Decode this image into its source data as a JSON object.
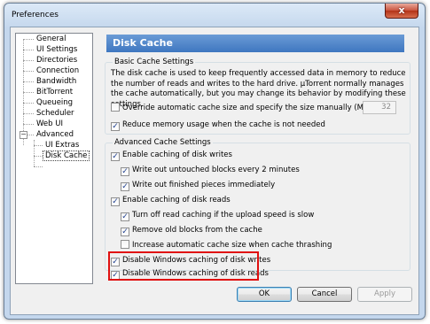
{
  "window": {
    "title": "Preferences",
    "close_glyph": "x"
  },
  "sidebar": {
    "items": [
      {
        "label": "General"
      },
      {
        "label": "UI Settings"
      },
      {
        "label": "Directories"
      },
      {
        "label": "Connection"
      },
      {
        "label": "Bandwidth"
      },
      {
        "label": "BitTorrent"
      },
      {
        "label": "Queueing"
      },
      {
        "label": "Scheduler"
      },
      {
        "label": "Web UI"
      },
      {
        "label": "Advanced",
        "expander": "−"
      },
      {
        "label": "UI Extras"
      },
      {
        "label": "Disk Cache",
        "selected": true
      }
    ]
  },
  "page": {
    "title": "Disk Cache",
    "basic": {
      "title": "Basic Cache Settings",
      "description": "The disk cache is used to keep frequently accessed data in memory to reduce the number of reads and writes to the hard drive. µTorrent normally manages the cache automatically, but you may change its behavior by modifying these settings.",
      "override_label": "Override automatic cache size and specify the size manually (MB):",
      "override_checked": false,
      "cache_size_value": "32",
      "reduce_label": "Reduce memory usage when the cache is not needed",
      "reduce_checked": true
    },
    "advanced": {
      "title": "Advanced Cache Settings",
      "options": [
        {
          "label": "Enable caching of disk writes",
          "checked": true
        },
        {
          "label": "Write out untouched blocks every 2 minutes",
          "checked": true
        },
        {
          "label": "Write out finished pieces immediately",
          "checked": true
        },
        {
          "label": "Enable caching of disk reads",
          "checked": true
        },
        {
          "label": "Turn off read caching if the upload speed is slow",
          "checked": true
        },
        {
          "label": "Remove old blocks from the cache",
          "checked": true
        },
        {
          "label": "Increase automatic cache size when cache thrashing",
          "checked": false
        },
        {
          "label": "Disable Windows caching of disk writes",
          "checked": true
        },
        {
          "label": "Disable Windows caching of disk reads",
          "checked": true
        }
      ]
    }
  },
  "buttons": {
    "ok": "OK",
    "cancel": "Cancel",
    "apply": "Apply"
  },
  "colors": {
    "header": "#3f77c0",
    "highlight": "#e01010"
  }
}
